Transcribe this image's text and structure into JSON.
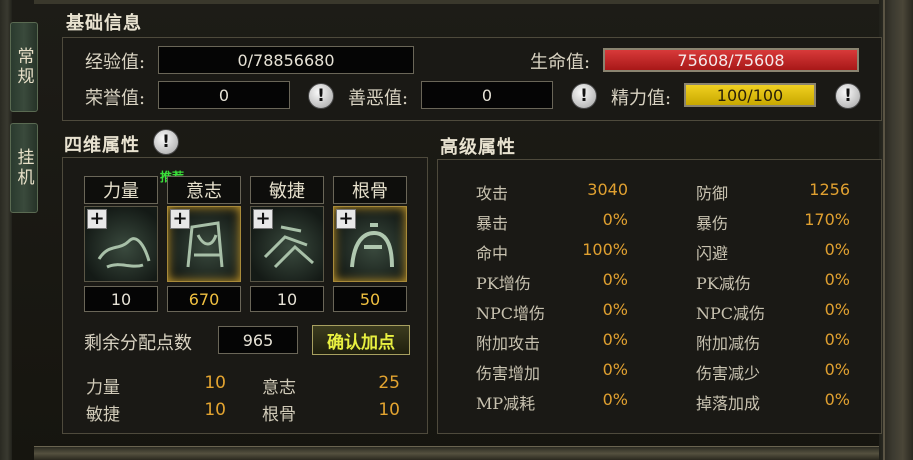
{
  "side_tabs": [
    {
      "label": "常规"
    },
    {
      "label": "挂机"
    }
  ],
  "basic": {
    "title": "基础信息",
    "exp_label": "经验值:",
    "exp_value": "0/78856680",
    "hp_label": "生命值:",
    "hp_value": "75608/75608",
    "hp_fill": 1.0,
    "honor_label": "荣誉值:",
    "honor_value": "0",
    "karma_label": "善恶值:",
    "karma_value": "0",
    "energy_label": "精力值:",
    "energy_value": "100/100",
    "energy_fill": 1.0
  },
  "four_dim": {
    "title": "四维属性",
    "recommend_label": "推荐",
    "attrs": [
      {
        "name": "力量",
        "value": "10",
        "icon": "strength-icon"
      },
      {
        "name": "意志",
        "value": "670",
        "icon": "willpower-icon"
      },
      {
        "name": "敏捷",
        "value": "10",
        "icon": "agility-icon"
      },
      {
        "name": "根骨",
        "value": "50",
        "icon": "constitution-icon"
      }
    ],
    "remaining_label": "剩余分配点数",
    "remaining_value": "965",
    "confirm_label": "确认加点",
    "base": [
      {
        "name": "力量",
        "value": "10"
      },
      {
        "name": "意志",
        "value": "25"
      },
      {
        "name": "敏捷",
        "value": "10"
      },
      {
        "name": "根骨",
        "value": "10"
      }
    ]
  },
  "advanced": {
    "title": "高级属性",
    "rows": [
      {
        "l1": "攻击",
        "v1": "3040",
        "l2": "防御",
        "v2": "1256"
      },
      {
        "l1": "暴击",
        "v1": "0%",
        "l2": "暴伤",
        "v2": "170%"
      },
      {
        "l1": "命中",
        "v1": "100%",
        "l2": "闪避",
        "v2": "0%"
      },
      {
        "l1": "PK增伤",
        "v1": "0%",
        "l2": "PK减伤",
        "v2": "0%"
      },
      {
        "l1": "NPC增伤",
        "v1": "0%",
        "l2": "NPC减伤",
        "v2": "0%"
      },
      {
        "l1": "附加攻击",
        "v1": "0%",
        "l2": "附加减伤",
        "v2": "0%"
      },
      {
        "l1": "伤害增加",
        "v1": "0%",
        "l2": "伤害减少",
        "v2": "0%"
      },
      {
        "l1": "MP减耗",
        "v1": "0%",
        "l2": "掉落加成",
        "v2": "0%"
      }
    ]
  }
}
